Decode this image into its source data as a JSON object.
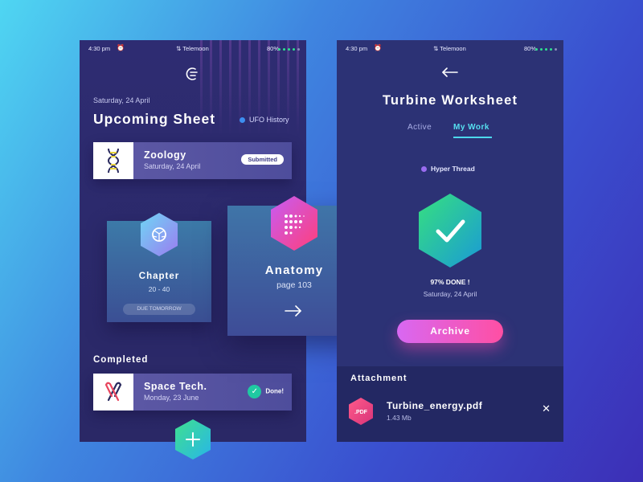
{
  "status_bar": {
    "time": "4:30 pm",
    "carrier": "Telemoon",
    "battery": "80%"
  },
  "left_screen": {
    "date": "Saturday, 24 April",
    "title": "Upcoming Sheet",
    "tag": {
      "label": "UFO History",
      "color": "#3d8ef0"
    },
    "zoology": {
      "name": "Zoology",
      "date": "Saturday, 24 April",
      "badge": "Submitted",
      "icon": "dna-icon"
    },
    "chapter": {
      "label": "Chapter",
      "range": "20 - 40",
      "due": "DUE TOMORROW",
      "icon": "soccer-ball-icon"
    },
    "anatomy": {
      "label": "Anatomy",
      "page": "page 103",
      "icon": "dot-grid-icon"
    },
    "completed_heading": "Completed",
    "space_tech": {
      "name": "Space Tech.",
      "date": "Monday, 23 June",
      "status": "Done!",
      "icon": "ribbon-icon"
    }
  },
  "right_screen": {
    "title": "Turbine Worksheet",
    "tabs": [
      {
        "label": "Active",
        "selected": false
      },
      {
        "label": "My Work",
        "selected": true
      }
    ],
    "tag": {
      "label": "Hyper Thread",
      "color": "#9a6cf0"
    },
    "progress": {
      "percent": 97,
      "label": "97% DONE !",
      "date": "Saturday, 24 April"
    },
    "archive_label": "Archive",
    "attachment": {
      "heading": "Attachment",
      "file_badge": ".PDF",
      "file_name": "Turbine_energy.pdf",
      "file_size": "1.43 Mb"
    }
  },
  "colors": {
    "accent_cyan": "#4dd8ec",
    "accent_pink": "#ff4fa3",
    "success_green": "#1fc9a2"
  }
}
